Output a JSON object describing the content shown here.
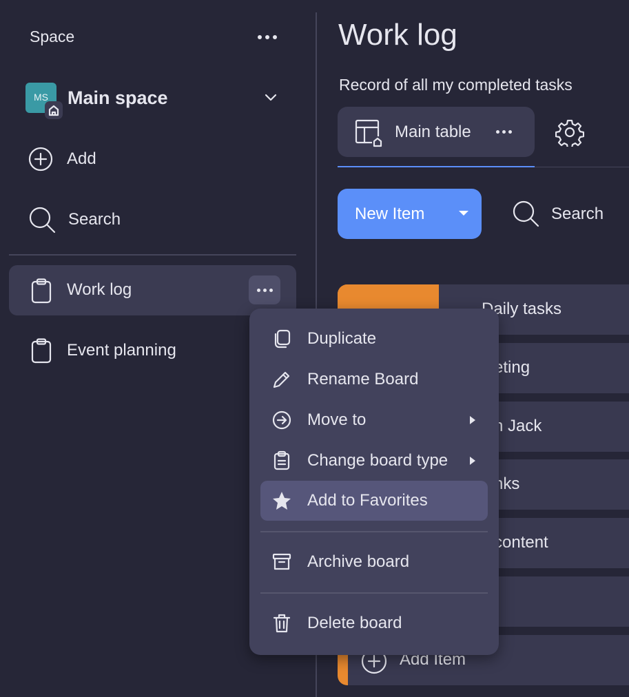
{
  "sidebar": {
    "space_label": "Space",
    "space_name": "Main space",
    "space_initials": "MS",
    "add_label": "Add",
    "search_label": "Search",
    "boards": [
      {
        "label": "Work log"
      },
      {
        "label": "Event planning"
      }
    ]
  },
  "main": {
    "title": "Work log",
    "description": "Record of all my completed tasks",
    "view_tab": "Main table",
    "new_item_label": "New Item",
    "search_label": "Search",
    "group_name": "Daily tasks",
    "rows": [
      "eting",
      "h Jack",
      "nks",
      "content",
      ""
    ],
    "add_item_label": "Add Item"
  },
  "context_menu": {
    "items": [
      {
        "label": "Duplicate"
      },
      {
        "label": "Rename Board"
      },
      {
        "label": "Move to"
      },
      {
        "label": "Change board type"
      },
      {
        "label": "Add to Favorites"
      },
      {
        "label": "Archive board"
      },
      {
        "label": "Delete board"
      }
    ]
  },
  "colors": {
    "background": "#262637",
    "accent": "#5b8ff9",
    "group": "#e8892f",
    "avatar": "#3a9aa5"
  }
}
